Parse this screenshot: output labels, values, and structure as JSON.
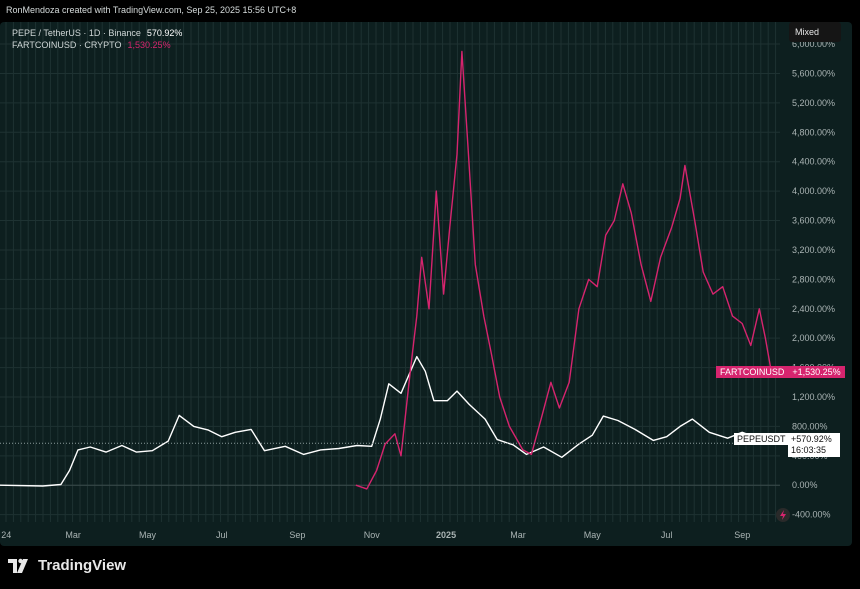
{
  "header": {
    "credit": "RonMendoza created with TradingView.com, Sep 25, 2025 15:56 UTC+8"
  },
  "legend": {
    "pepe": {
      "label": "PEPE / TetherUS · 1D · Binance",
      "value": "570.92%"
    },
    "fart": {
      "label": "FARTCOINUSD · CRYPTO",
      "value": "1,530.25%"
    }
  },
  "scale_mode": "Mixed",
  "price_tags": {
    "fart_name": "FARTCOINUSD",
    "fart_value": "+1,530.25%",
    "pepe_name": "PEPEUSDT",
    "pepe_value": "+570.92%",
    "pepe_countdown": "16:03:35"
  },
  "brand": {
    "name": "TradingView"
  },
  "colors": {
    "background": "#0d1f1f",
    "pepe": "#ffffff",
    "fart": "#d6246e",
    "grid": "#1e3232",
    "axis_text": "#aab4b4"
  },
  "chart_data": {
    "type": "line",
    "title": "",
    "xlabel": "",
    "ylabel": "",
    "y_unit": "%",
    "ylim": [
      -500,
      6300
    ],
    "y_ticks": [
      -400,
      0,
      400,
      800,
      1200,
      1600,
      2000,
      2400,
      2800,
      3200,
      3600,
      4000,
      4400,
      4800,
      5200,
      5600,
      6000
    ],
    "y_tick_labels": [
      "-400.00%",
      "0.00%",
      "400.00%",
      "800.00%",
      "1,200.00%",
      "1,600.00%",
      "2,000.00%",
      "2,400.00%",
      "2,800.00%",
      "3,200.00%",
      "3,600.00%",
      "4,000.00%",
      "4,400.00%",
      "4,800.00%",
      "5,200.00%",
      "5,600.00%",
      "6,000.00%"
    ],
    "x_range": [
      "2024-01-01",
      "2025-10-02"
    ],
    "x_ticks": [
      {
        "date": "2024-01-02",
        "label": "24"
      },
      {
        "date": "2024-03-01",
        "label": "Mar"
      },
      {
        "date": "2024-05-01",
        "label": "May"
      },
      {
        "date": "2024-07-01",
        "label": "Jul"
      },
      {
        "date": "2024-09-01",
        "label": "Sep"
      },
      {
        "date": "2024-11-01",
        "label": "Nov"
      },
      {
        "date": "2025-01-01",
        "label": "2025"
      },
      {
        "date": "2025-03-01",
        "label": "Mar"
      },
      {
        "date": "2025-05-01",
        "label": "May"
      },
      {
        "date": "2025-07-01",
        "label": "Jul"
      },
      {
        "date": "2025-09-01",
        "label": "Sep"
      }
    ],
    "grid": true,
    "series": [
      {
        "name": "PEPEUSDT",
        "color": "#ffffff",
        "points": [
          [
            "2024-01-01",
            0
          ],
          [
            "2024-02-05",
            -10
          ],
          [
            "2024-02-20",
            10
          ],
          [
            "2024-02-27",
            200
          ],
          [
            "2024-03-05",
            480
          ],
          [
            "2024-03-15",
            520
          ],
          [
            "2024-03-28",
            450
          ],
          [
            "2024-04-10",
            540
          ],
          [
            "2024-04-22",
            450
          ],
          [
            "2024-05-05",
            470
          ],
          [
            "2024-05-18",
            600
          ],
          [
            "2024-05-27",
            950
          ],
          [
            "2024-06-08",
            800
          ],
          [
            "2024-06-20",
            750
          ],
          [
            "2024-07-01",
            660
          ],
          [
            "2024-07-12",
            720
          ],
          [
            "2024-07-25",
            760
          ],
          [
            "2024-08-05",
            470
          ],
          [
            "2024-08-22",
            530
          ],
          [
            "2024-09-06",
            420
          ],
          [
            "2024-09-20",
            480
          ],
          [
            "2024-10-05",
            500
          ],
          [
            "2024-10-20",
            540
          ],
          [
            "2024-11-01",
            530
          ],
          [
            "2024-11-08",
            900
          ],
          [
            "2024-11-15",
            1380
          ],
          [
            "2024-11-25",
            1250
          ],
          [
            "2024-12-08",
            1750
          ],
          [
            "2024-12-15",
            1550
          ],
          [
            "2024-12-22",
            1150
          ],
          [
            "2025-01-02",
            1150
          ],
          [
            "2025-01-10",
            1280
          ],
          [
            "2025-01-20",
            1100
          ],
          [
            "2025-02-02",
            900
          ],
          [
            "2025-02-12",
            620
          ],
          [
            "2025-02-25",
            550
          ],
          [
            "2025-03-08",
            420
          ],
          [
            "2025-03-22",
            520
          ],
          [
            "2025-04-06",
            380
          ],
          [
            "2025-04-20",
            560
          ],
          [
            "2025-05-01",
            680
          ],
          [
            "2025-05-10",
            940
          ],
          [
            "2025-05-22",
            880
          ],
          [
            "2025-06-05",
            760
          ],
          [
            "2025-06-20",
            610
          ],
          [
            "2025-07-01",
            660
          ],
          [
            "2025-07-12",
            800
          ],
          [
            "2025-07-22",
            900
          ],
          [
            "2025-08-05",
            720
          ],
          [
            "2025-08-20",
            640
          ],
          [
            "2025-09-01",
            720
          ],
          [
            "2025-09-12",
            650
          ],
          [
            "2025-09-25",
            571
          ]
        ]
      },
      {
        "name": "FARTCOINUSD",
        "color": "#d6246e",
        "points": [
          [
            "2024-10-19",
            0
          ],
          [
            "2024-10-28",
            -50
          ],
          [
            "2024-11-05",
            200
          ],
          [
            "2024-11-12",
            560
          ],
          [
            "2024-11-20",
            700
          ],
          [
            "2024-11-25",
            400
          ],
          [
            "2024-12-03",
            1600
          ],
          [
            "2024-12-08",
            2300
          ],
          [
            "2024-12-12",
            3100
          ],
          [
            "2024-12-18",
            2400
          ],
          [
            "2024-12-24",
            4000
          ],
          [
            "2024-12-30",
            2600
          ],
          [
            "2025-01-04",
            3500
          ],
          [
            "2025-01-10",
            4500
          ],
          [
            "2025-01-14",
            5900
          ],
          [
            "2025-01-19",
            4600
          ],
          [
            "2025-01-25",
            3000
          ],
          [
            "2025-02-01",
            2300
          ],
          [
            "2025-02-07",
            1800
          ],
          [
            "2025-02-14",
            1200
          ],
          [
            "2025-02-22",
            800
          ],
          [
            "2025-03-05",
            480
          ],
          [
            "2025-03-12",
            420
          ],
          [
            "2025-03-20",
            900
          ],
          [
            "2025-03-28",
            1400
          ],
          [
            "2025-04-04",
            1050
          ],
          [
            "2025-04-12",
            1400
          ],
          [
            "2025-04-20",
            2400
          ],
          [
            "2025-04-28",
            2800
          ],
          [
            "2025-05-05",
            2700
          ],
          [
            "2025-05-12",
            3400
          ],
          [
            "2025-05-19",
            3600
          ],
          [
            "2025-05-26",
            4100
          ],
          [
            "2025-06-02",
            3700
          ],
          [
            "2025-06-10",
            3000
          ],
          [
            "2025-06-18",
            2500
          ],
          [
            "2025-06-26",
            3100
          ],
          [
            "2025-07-05",
            3500
          ],
          [
            "2025-07-12",
            3900
          ],
          [
            "2025-07-16",
            4350
          ],
          [
            "2025-07-24",
            3600
          ],
          [
            "2025-07-31",
            2900
          ],
          [
            "2025-08-08",
            2600
          ],
          [
            "2025-08-16",
            2700
          ],
          [
            "2025-08-24",
            2300
          ],
          [
            "2025-09-01",
            2200
          ],
          [
            "2025-09-08",
            1900
          ],
          [
            "2025-09-15",
            2400
          ],
          [
            "2025-09-20",
            2000
          ],
          [
            "2025-09-25",
            1530
          ]
        ]
      }
    ]
  }
}
